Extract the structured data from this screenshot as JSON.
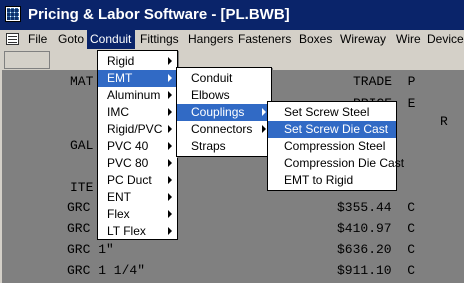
{
  "window": {
    "title": "Pricing & Labor Software - [PL.BWB]"
  },
  "menubar": {
    "items": [
      "File",
      "Goto",
      "Conduit",
      "Fittings",
      "Hangers",
      "Fasteners",
      "Boxes",
      "Wireway",
      "Wire",
      "Devices"
    ],
    "active": "Conduit"
  },
  "document": {
    "lines": [
      "MAT",
      "TRADE  P",
      "PRICE  E",
      "R",
      "GAL",
      "ITE",
      "GRC",
      "$355.44  C",
      "GRC",
      "$410.97  C",
      "GRC 1\"",
      "$636.20  C",
      "GRC 1 1/4\"",
      "$911.10  C"
    ]
  },
  "menus": {
    "conduit": {
      "items": [
        "Rigid",
        "EMT",
        "Aluminum",
        "IMC",
        "Rigid/PVC",
        "PVC 40",
        "PVC 80",
        "PC Duct",
        "ENT",
        "Flex",
        "LT Flex"
      ],
      "selected": "EMT"
    },
    "emt": {
      "items": [
        "Conduit",
        "Elbows",
        "Couplings",
        "Connectors",
        "Straps"
      ],
      "selected": "Couplings"
    },
    "couplings": {
      "items": [
        "Set Screw Steel",
        "Set Screw Die Cast",
        "Compression Steel",
        "Compression Die Cast",
        "EMT to Rigid"
      ],
      "selected": "Set Screw Die Cast"
    }
  }
}
